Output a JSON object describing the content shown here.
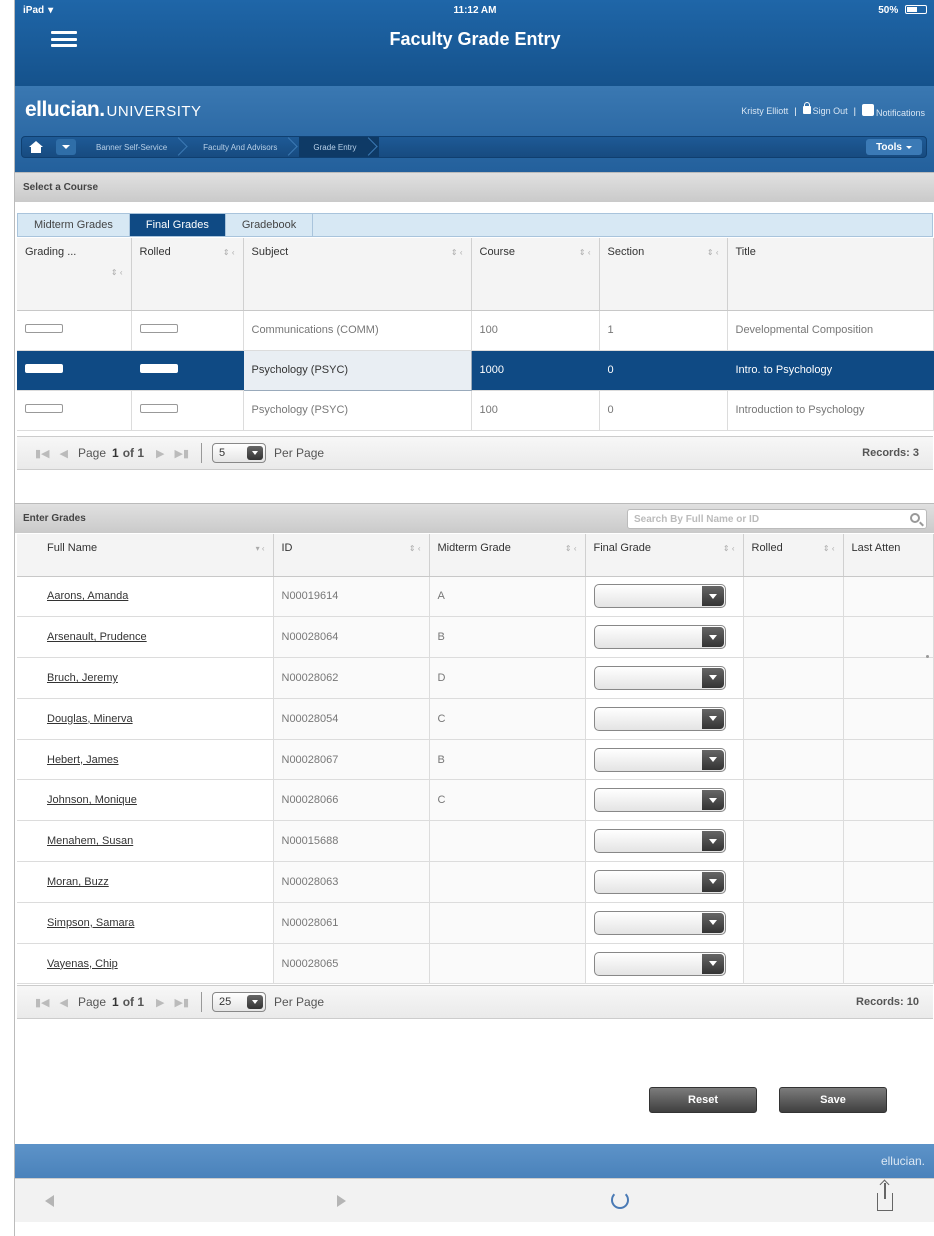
{
  "status": {
    "device": "iPad",
    "time": "11:12 AM",
    "battery": "50%"
  },
  "nav": {
    "title": "Faculty Grade Entry"
  },
  "brand": {
    "name": "ellucian.",
    "suffix": "UNIVERSITY"
  },
  "user": {
    "name": "Kristy Elliott",
    "sign_out": "Sign Out",
    "notifications": "Notifications"
  },
  "breadcrumbs": [
    "Banner Self-Service",
    "Faculty And Advisors",
    "Grade Entry"
  ],
  "tools_label": "Tools",
  "course_section": {
    "header": "Select a Course",
    "tabs": [
      "Midterm Grades",
      "Final Grades",
      "Gradebook"
    ],
    "columns": [
      "Grading ...",
      "Rolled",
      "Subject",
      "Course",
      "Section",
      "Title"
    ],
    "rows": [
      {
        "subject": "Communications (COMM)",
        "course": "100",
        "section": "1",
        "title": "Developmental Composition"
      },
      {
        "subject": "Psychology (PSYC)",
        "course": "1000",
        "section": "0",
        "title": "Intro. to Psychology"
      },
      {
        "subject": "Psychology (PSYC)",
        "course": "100",
        "section": "0",
        "title": "Introduction to Psychology"
      }
    ],
    "pager": {
      "page_label": "Page",
      "page": "1",
      "of": "of 1",
      "per_page": "5",
      "per_page_label": "Per Page",
      "records": "Records: 3"
    }
  },
  "grades_section": {
    "header": "Enter Grades",
    "search_placeholder": "Search By Full Name or ID",
    "columns": [
      "Full Name",
      "ID",
      "Midterm Grade",
      "Final Grade",
      "Rolled",
      "Last Atten"
    ],
    "rows": [
      {
        "name": "Aarons, Amanda",
        "id": "N00019614",
        "midterm": "A"
      },
      {
        "name": "Arsenault, Prudence",
        "id": "N00028064",
        "midterm": "B"
      },
      {
        "name": "Bruch, Jeremy",
        "id": "N00028062",
        "midterm": "D"
      },
      {
        "name": "Douglas, Minerva",
        "id": "N00028054",
        "midterm": "C"
      },
      {
        "name": "Hebert, James",
        "id": "N00028067",
        "midterm": "B"
      },
      {
        "name": "Johnson, Monique",
        "id": "N00028066",
        "midterm": "C"
      },
      {
        "name": "Menahem, Susan",
        "id": "N00015688",
        "midterm": ""
      },
      {
        "name": "Moran, Buzz",
        "id": "N00028063",
        "midterm": ""
      },
      {
        "name": "Simpson, Samara",
        "id": "N00028061",
        "midterm": ""
      },
      {
        "name": "Vayenas, Chip",
        "id": "N00028065",
        "midterm": ""
      }
    ],
    "pager": {
      "page_label": "Page",
      "page": "1",
      "of": "of 1",
      "per_page": "25",
      "per_page_label": "Per Page",
      "records": "Records: 10"
    }
  },
  "buttons": {
    "reset": "Reset",
    "save": "Save"
  },
  "footer_brand": "ellucian."
}
